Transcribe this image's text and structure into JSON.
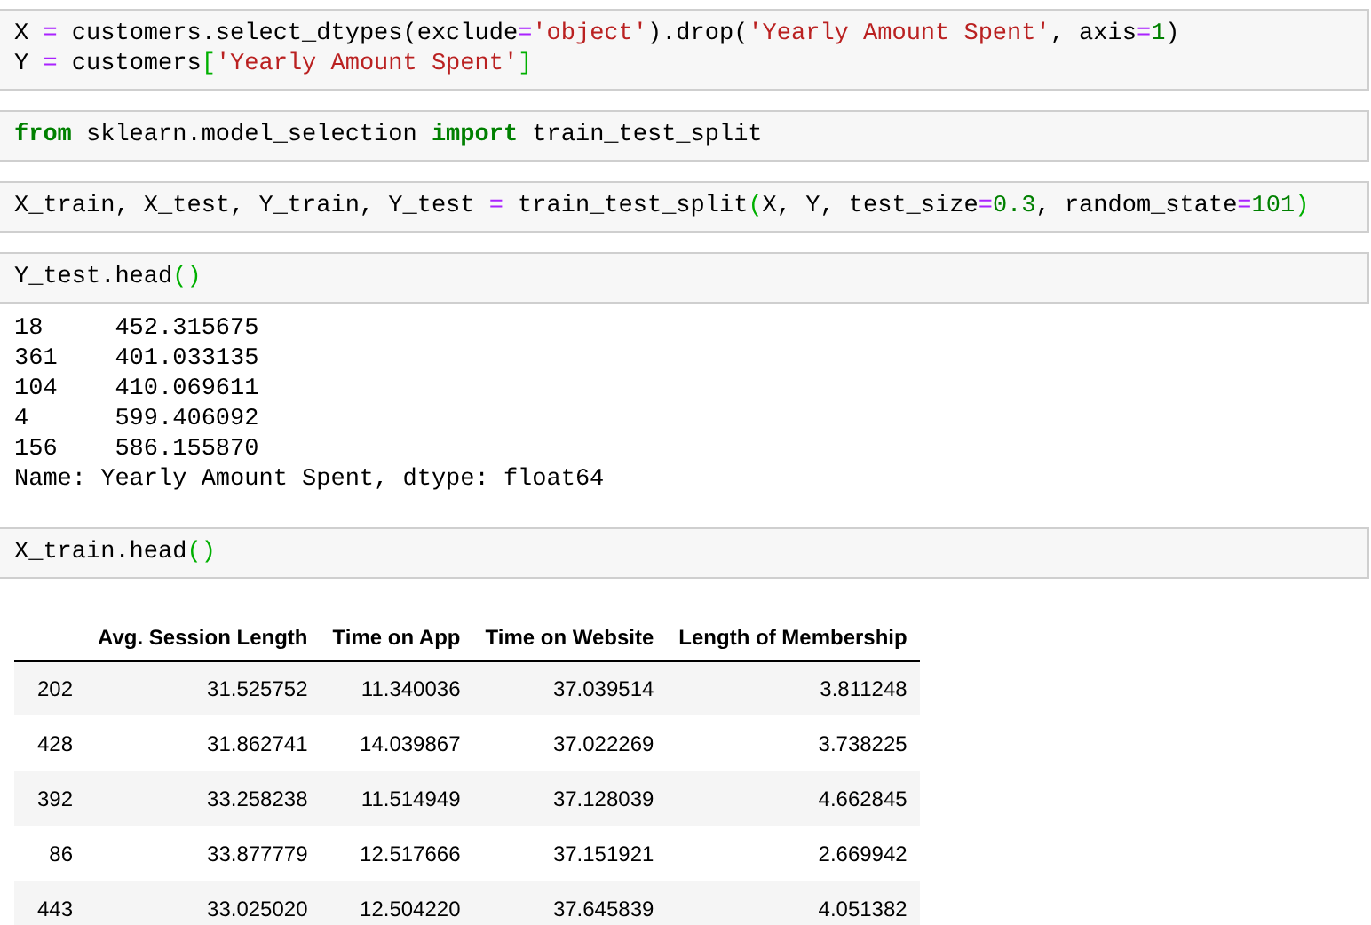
{
  "cells": [
    {
      "kind": "code",
      "lines": [
        [
          {
            "text": "X ",
            "kind": "plain"
          },
          {
            "text": "=",
            "kind": "operator"
          },
          {
            "text": " customers.select_dtypes(exclude",
            "kind": "plain"
          },
          {
            "text": "=",
            "kind": "operator"
          },
          {
            "text": "'object'",
            "kind": "string"
          },
          {
            "text": ").drop(",
            "kind": "plain"
          },
          {
            "text": "'Yearly Amount Spent'",
            "kind": "string"
          },
          {
            "text": ", axis",
            "kind": "plain"
          },
          {
            "text": "=",
            "kind": "operator"
          },
          {
            "text": "1",
            "kind": "number"
          },
          {
            "text": ")",
            "kind": "plain"
          }
        ],
        [
          {
            "text": "Y ",
            "kind": "plain"
          },
          {
            "text": "=",
            "kind": "operator"
          },
          {
            "text": " customers",
            "kind": "plain"
          },
          {
            "text": "[",
            "kind": "bracket"
          },
          {
            "text": "'Yearly Amount Spent'",
            "kind": "string"
          },
          {
            "text": "]",
            "kind": "bracket"
          }
        ]
      ]
    },
    {
      "kind": "code",
      "lines": [
        [
          {
            "text": "from",
            "kind": "keyword"
          },
          {
            "text": " sklearn.model_selection ",
            "kind": "plain"
          },
          {
            "text": "import",
            "kind": "keyword"
          },
          {
            "text": " train_test_split",
            "kind": "plain"
          }
        ]
      ]
    },
    {
      "kind": "code",
      "lines": [
        [
          {
            "text": "X_train, X_test, Y_train, Y_test ",
            "kind": "plain"
          },
          {
            "text": "=",
            "kind": "operator"
          },
          {
            "text": " train_test_split",
            "kind": "plain"
          },
          {
            "text": "(",
            "kind": "bracket"
          },
          {
            "text": "X, Y, test_size",
            "kind": "plain"
          },
          {
            "text": "=",
            "kind": "operator"
          },
          {
            "text": "0.3",
            "kind": "number"
          },
          {
            "text": ", random_state",
            "kind": "plain"
          },
          {
            "text": "=",
            "kind": "operator"
          },
          {
            "text": "101",
            "kind": "number"
          },
          {
            "text": ")",
            "kind": "bracket"
          }
        ]
      ]
    },
    {
      "kind": "code",
      "lines": [
        [
          {
            "text": "Y_test.head",
            "kind": "plain"
          },
          {
            "text": "()",
            "kind": "bracket"
          }
        ]
      ]
    },
    {
      "kind": "stream",
      "lines": [
        "18     452.315675",
        "361    401.033135",
        "104    410.069611",
        "4      599.406092",
        "156    586.155870",
        "Name: Yearly Amount Spent, dtype: float64"
      ]
    },
    {
      "kind": "code",
      "lines": [
        [
          {
            "text": "X_train.head",
            "kind": "plain"
          },
          {
            "text": "()",
            "kind": "bracket"
          }
        ]
      ]
    },
    {
      "kind": "dataframe",
      "columns": [
        "Avg. Session Length",
        "Time on App",
        "Time on Website",
        "Length of Membership"
      ],
      "rows": [
        {
          "index": "202",
          "values": [
            "31.525752",
            "11.340036",
            "37.039514",
            "3.811248"
          ]
        },
        {
          "index": "428",
          "values": [
            "31.862741",
            "14.039867",
            "37.022269",
            "3.738225"
          ]
        },
        {
          "index": "392",
          "values": [
            "33.258238",
            "11.514949",
            "37.128039",
            "4.662845"
          ]
        },
        {
          "index": "86",
          "values": [
            "33.877779",
            "12.517666",
            "37.151921",
            "2.669942"
          ]
        },
        {
          "index": "443",
          "values": [
            "33.025020",
            "12.504220",
            "37.645839",
            "4.051382"
          ]
        }
      ]
    }
  ]
}
